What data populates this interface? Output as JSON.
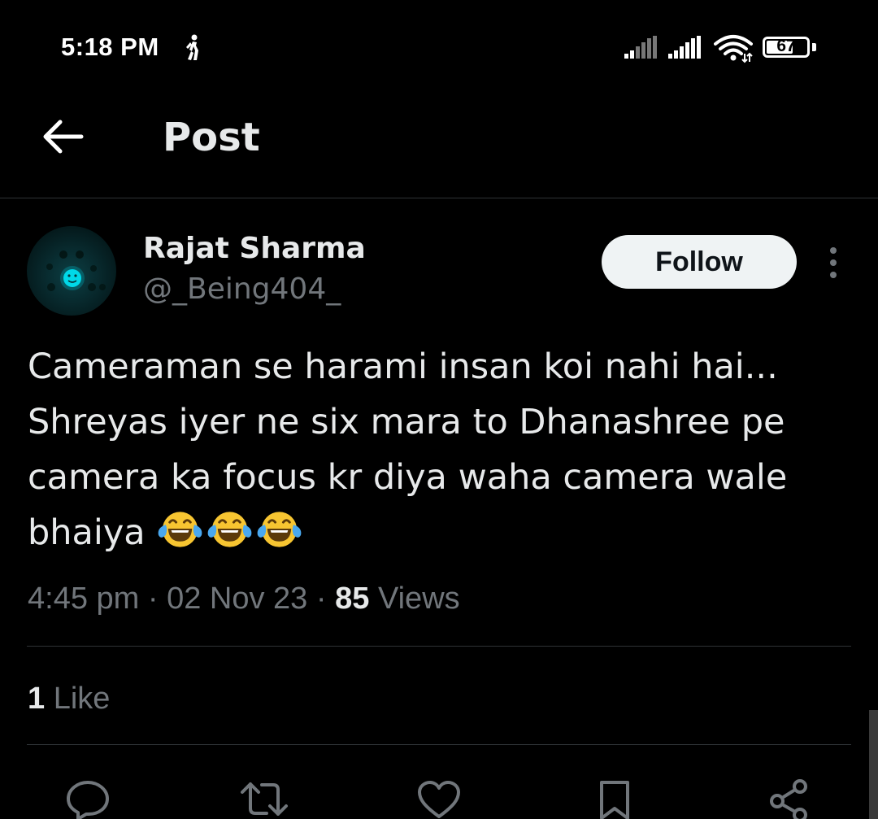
{
  "status_bar": {
    "time": "5:18 PM",
    "battery": "67",
    "battery_level": 0.67,
    "icons": [
      "walking-icon",
      "signal-icon",
      "signal-icon",
      "wifi-icon",
      "battery-icon"
    ]
  },
  "header": {
    "title": "Post",
    "back_icon": "arrow-left-icon"
  },
  "author": {
    "name": "Rajat Sharma",
    "handle": "@_Being404_",
    "follow_label": "Follow",
    "more_icon": "more-vertical-icon"
  },
  "post": {
    "text": "Cameraman se harami insan koi nahi hai...\nShreyas iyer ne six mara to Dhanashree pe\ncamera ka focus kr diya waha camera wale\nbhaiya ",
    "emojis": [
      "😂",
      "😂",
      "😂"
    ],
    "time": "4:45 pm",
    "sep": "·",
    "date": "02 Nov 23",
    "views_count": "85",
    "views_label": "Views"
  },
  "engagement": {
    "likes_count": "1",
    "likes_label": "Like"
  },
  "actions": [
    "reply-icon",
    "repost-icon",
    "like-icon",
    "bookmark-icon",
    "share-icon"
  ],
  "colors": {
    "background": "#000000",
    "text_primary": "#e7e9ea",
    "text_secondary": "#71767b",
    "divider": "#2f3336",
    "follow_bg": "#eff3f4",
    "avatar_glow": "#00d8e8"
  }
}
